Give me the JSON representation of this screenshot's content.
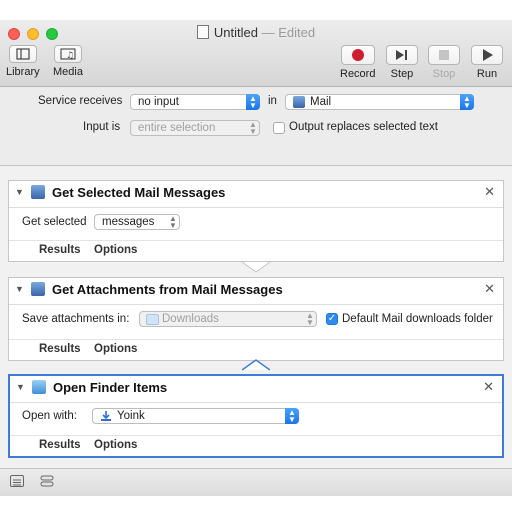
{
  "window": {
    "title": "Untitled",
    "edited_label": "— Edited"
  },
  "toolbar": {
    "library_label": "Library",
    "media_label": "Media",
    "record_label": "Record",
    "step_label": "Step",
    "stop_label": "Stop",
    "run_label": "Run"
  },
  "service": {
    "receives_label": "Service receives",
    "receives_value": "no input",
    "in_label": "in",
    "app_value": "Mail",
    "input_is_label": "Input is",
    "input_is_value": "entire selection",
    "output_replaces_label": "Output replaces selected text",
    "output_replaces_checked": false
  },
  "actions": [
    {
      "title": "Get Selected Mail Messages",
      "field_label": "Get selected",
      "field_value": "messages",
      "results_label": "Results",
      "options_label": "Options"
    },
    {
      "title": "Get Attachments from Mail Messages",
      "field_label": "Save attachments in:",
      "field_value": "Downloads",
      "checkbox_label": "Default Mail downloads folder",
      "checkbox_checked": true,
      "results_label": "Results",
      "options_label": "Options"
    },
    {
      "title": "Open Finder Items",
      "field_label": "Open with:",
      "field_value": "Yoink",
      "results_label": "Results",
      "options_label": "Options"
    }
  ],
  "colors": {
    "accent": "#3b7dd8",
    "record": "#cc1e2e",
    "checkbox": "#2e8cf0"
  }
}
